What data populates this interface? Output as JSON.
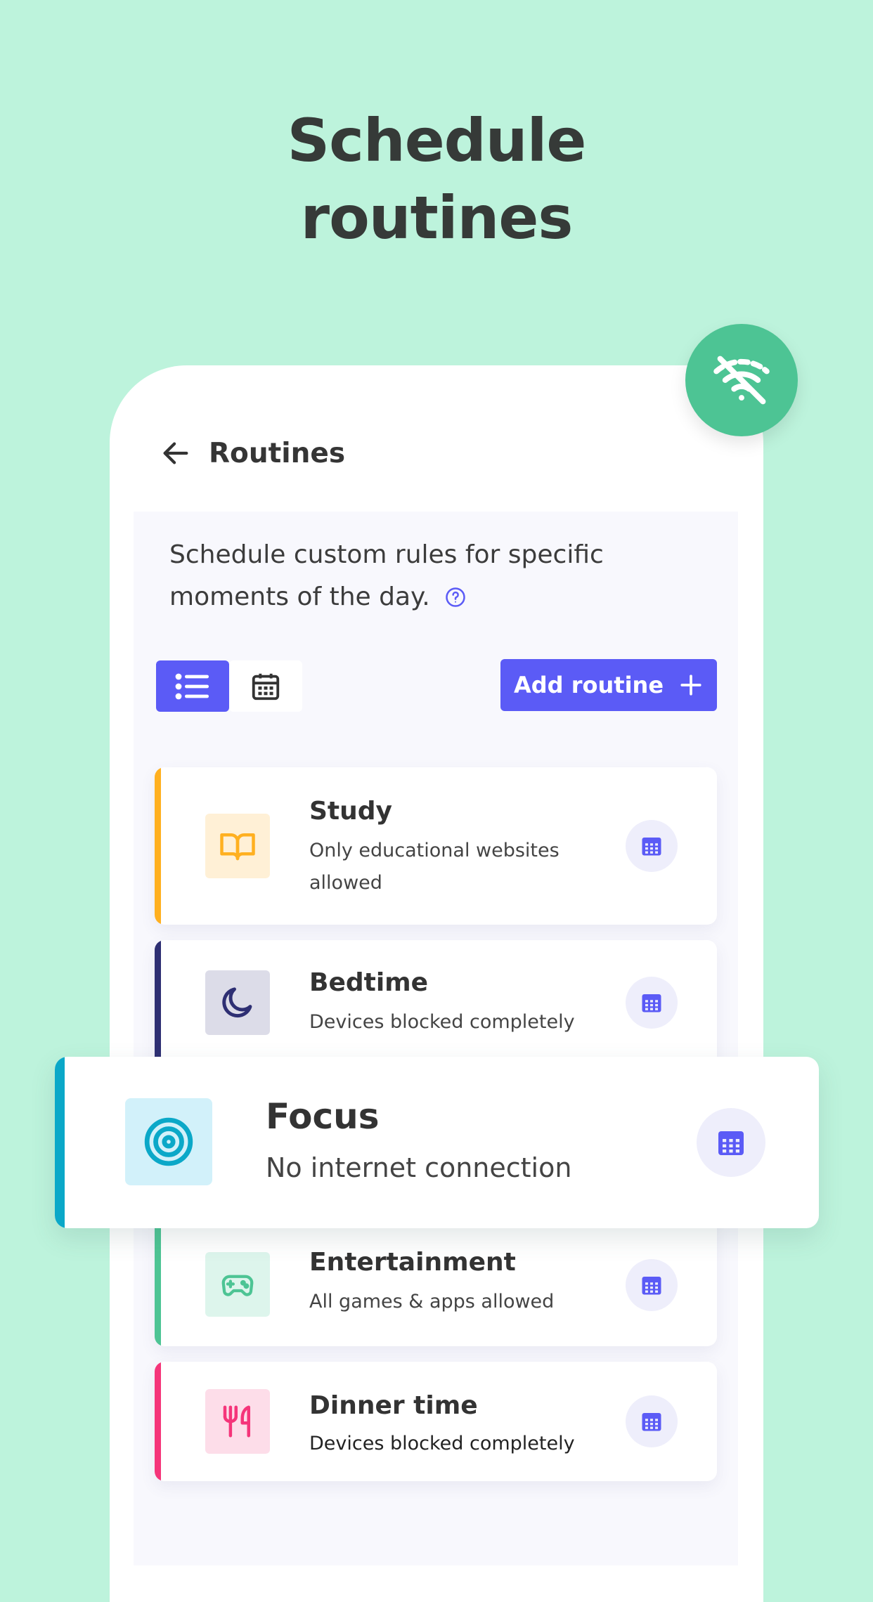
{
  "headline": {
    "line1": "Schedule",
    "line2": "routines"
  },
  "header": {
    "title": "Routines",
    "back_icon": "arrow-left-icon"
  },
  "badge": {
    "icon": "wifi-off-icon",
    "color": "#4DC494"
  },
  "description": {
    "text": "Schedule custom rules for specific moments of the day.",
    "help_icon": "question-circle-icon"
  },
  "view_toggle": {
    "list_icon": "list-icon",
    "calendar_icon": "calendar-icon",
    "active": "list"
  },
  "add_button": {
    "label": "Add routine",
    "icon": "plus-icon"
  },
  "colors": {
    "accent": "#5B5BF6",
    "background": "#BDF3DC"
  },
  "routines": [
    {
      "title": "Study",
      "subtitle": "Only educational websites allowed",
      "icon": "book-icon",
      "color": "#FFB020"
    },
    {
      "title": "Bedtime",
      "subtitle": "Devices blocked completely",
      "icon": "moon-icon",
      "color": "#2E2F73"
    },
    {
      "title": "Focus",
      "subtitle": "No internet connection",
      "icon": "target-icon",
      "color": "#0BA8C8"
    },
    {
      "title": "Entertainment",
      "subtitle": "All games & apps allowed",
      "icon": "gamepad-icon",
      "color": "#4DC494"
    },
    {
      "title": "Dinner time",
      "subtitle": "Devices blocked completely",
      "icon": "utensils-icon",
      "color": "#F5357A"
    }
  ]
}
